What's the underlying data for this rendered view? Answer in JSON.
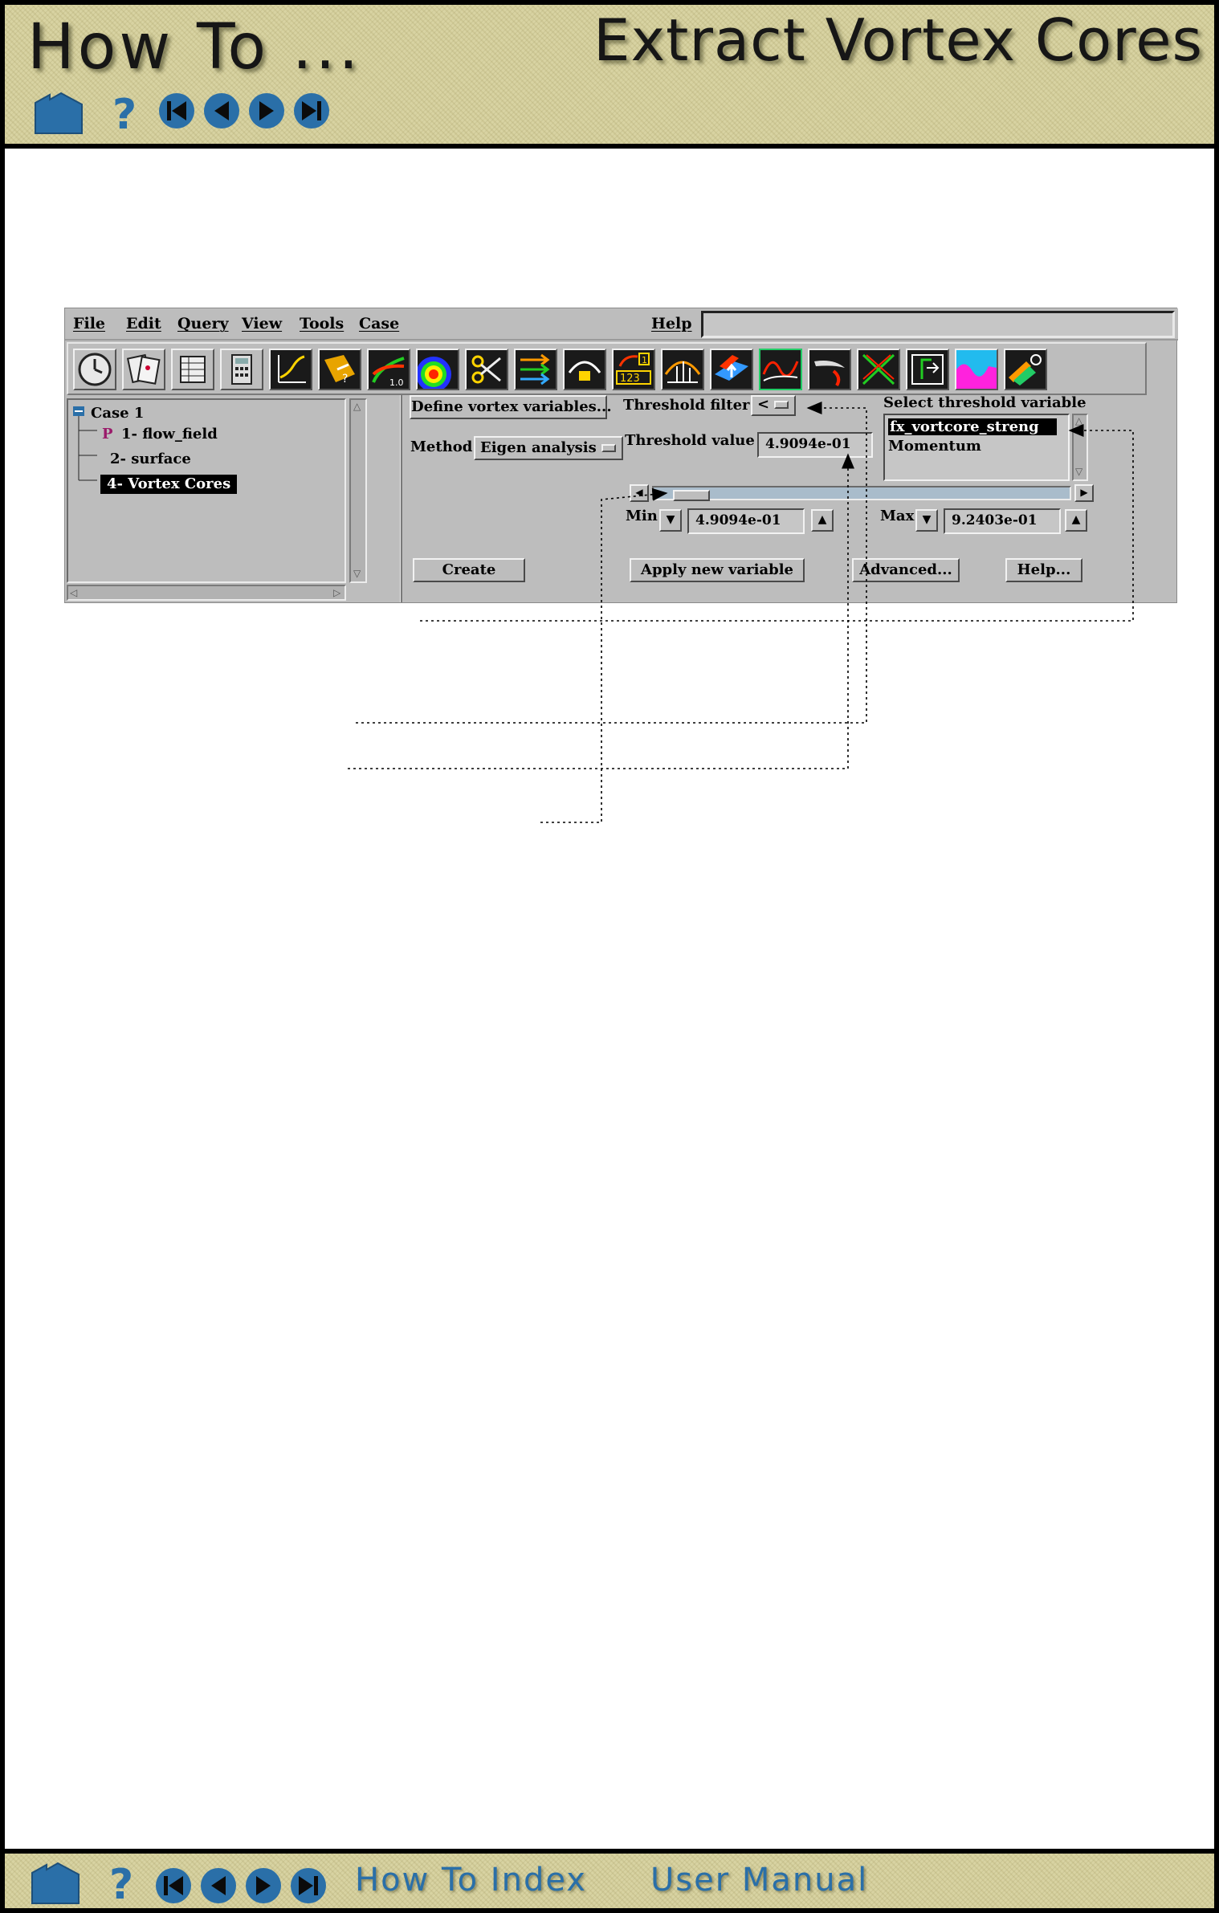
{
  "header": {
    "title_left": "How To ...",
    "title_right": "Extract Vortex Cores",
    "nav_icons": [
      "home-icon",
      "help-icon",
      "first-page-icon",
      "previous-page-icon",
      "next-page-icon",
      "last-page-icon"
    ]
  },
  "app": {
    "menus": [
      "File",
      "Edit",
      "Query",
      "View",
      "Tools",
      "Case",
      "Help"
    ],
    "toolbar_icons": [
      "clock-icon",
      "cards-icon",
      "table-icon",
      "calculator-icon",
      "graph-icon",
      "query-probe-icon",
      "scalar-range-icon",
      "contour-icon",
      "scissors-clip-icon",
      "vector-arrows-icon",
      "elevation-icon",
      "animation-counter-icon",
      "profile-icon",
      "flow-surface-icon",
      "particle-trace-icon",
      "isosurface-icon",
      "vortex-core-icon",
      "separation-icon",
      "color-palette-icon",
      "objects-icon"
    ],
    "tree": {
      "case": "Case 1",
      "items": [
        {
          "prefix": "P",
          "label": "1- flow_field"
        },
        {
          "prefix": "",
          "label": "2- surface"
        },
        {
          "prefix": "",
          "label": "4- Vortex Cores"
        }
      ]
    },
    "panel": {
      "define_button": "Define vortex variables...",
      "method_label": "Method",
      "method_value": "Eigen analysis",
      "threshold_filter_label": "Threshold filter",
      "threshold_filter_value": "<",
      "threshold_value_label": "Threshold value",
      "threshold_value": "4.9094e-01",
      "select_variable_label": "Select threshold variable",
      "variables": [
        "fx_vortcore_streng",
        "Momentum"
      ],
      "selected_variable": "fx_vortcore_streng",
      "slider_position": 0.05,
      "min_label": "Min",
      "min_value": "4.9094e-01",
      "max_label": "Max",
      "max_value": "9.2403e-01",
      "create_button": "Create",
      "apply_button": "Apply new variable",
      "advanced_button": "Advanced...",
      "help_button": "Help..."
    }
  },
  "footer": {
    "links": [
      "How To Index",
      "User Manual"
    ],
    "nav_icons": [
      "home-icon",
      "help-icon",
      "first-page-icon",
      "previous-page-icon",
      "next-page-icon",
      "last-page-icon"
    ]
  },
  "colors": {
    "header_bg": "#d8d3a2",
    "nav_blue": "#2a6fa8",
    "app_gray": "#bdbdbd",
    "slider_track": "#a9bccb"
  }
}
